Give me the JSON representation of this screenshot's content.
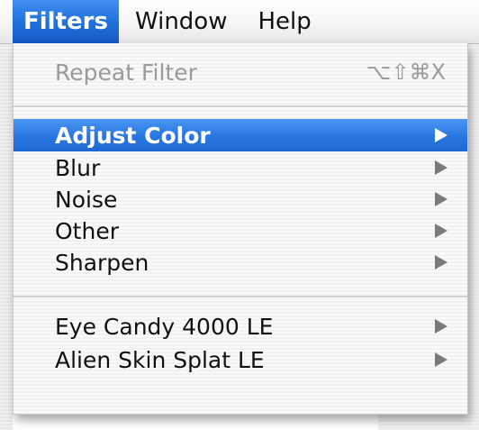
{
  "menubar": {
    "items": [
      {
        "label": "Filters",
        "active": true
      },
      {
        "label": "Window",
        "active": false
      },
      {
        "label": "Help",
        "active": false
      }
    ]
  },
  "menu": {
    "repeat_filter": {
      "label": "Repeat Filter",
      "shortcut": "⌥⇧⌘X",
      "enabled": false
    },
    "adjust_color": {
      "label": "Adjust Color",
      "submenu": true,
      "highlighted": true
    },
    "blur": {
      "label": "Blur",
      "submenu": true
    },
    "noise": {
      "label": "Noise",
      "submenu": true
    },
    "other": {
      "label": "Other",
      "submenu": true
    },
    "sharpen": {
      "label": "Sharpen",
      "submenu": true
    },
    "eye_candy": {
      "label": " Eye Candy 4000 LE",
      "submenu": true
    },
    "alien_skin": {
      "label": "Alien Skin Splat LE",
      "submenu": true
    }
  },
  "colors": {
    "highlight": "#2a78e2",
    "disabled_text": "#9a9a9a"
  },
  "icons": {
    "submenu_arrow": "triangle-right-icon"
  }
}
